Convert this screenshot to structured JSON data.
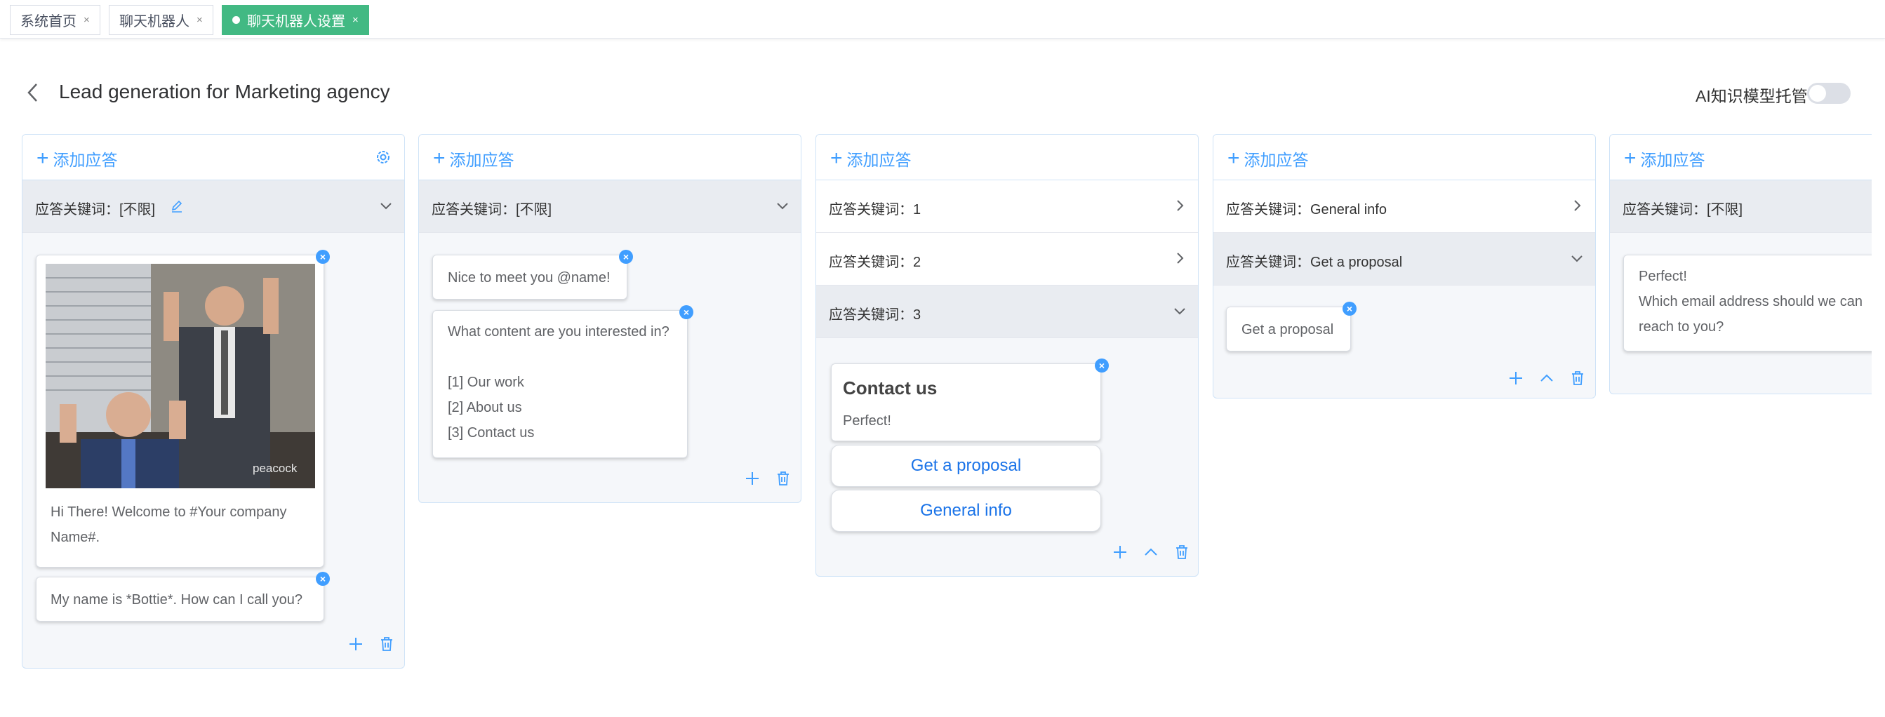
{
  "tabs": [
    {
      "label": "系统首页"
    },
    {
      "label": "聊天机器人"
    },
    {
      "label": "聊天机器人设置"
    }
  ],
  "page": {
    "title": "Lead generation for Marketing agency",
    "ai_label": "AI知识模型托管",
    "ai_enabled": false
  },
  "common": {
    "add_label": "添加应答",
    "close_glyph": "×"
  },
  "columns": [
    {
      "keywords": [
        {
          "label": "应答关键词：[不限]",
          "open": true
        }
      ],
      "cards": [
        {
          "image_watermark": "peacock",
          "text": "Hi There! Welcome to #Your company Name#."
        },
        {
          "text": "My name is *Bottie*. How can I call you?"
        }
      ]
    },
    {
      "keywords": [
        {
          "label": "应答关键词：[不限]",
          "open": true
        }
      ],
      "cards": [
        {
          "text": "Nice to meet you @name!"
        },
        {
          "lines": [
            "What content are you interested in?",
            "",
            "[1] Our work",
            "[2] About us",
            "[3] Contact us"
          ]
        }
      ]
    },
    {
      "keywords": [
        {
          "label": "应答关键词：1",
          "open": false
        },
        {
          "label": "应答关键词：2",
          "open": false
        },
        {
          "label": "应答关键词：3",
          "open": true
        }
      ],
      "cards": [
        {
          "title": "Contact us",
          "text": "Perfect!"
        }
      ],
      "buttons": [
        "Get a proposal",
        "General info"
      ]
    },
    {
      "keywords": [
        {
          "label": "应答关键词：General info",
          "open": false
        },
        {
          "label": "应答关键词：Get a proposal",
          "open": true
        }
      ],
      "cards": [
        {
          "text": "Get a proposal"
        }
      ]
    },
    {
      "keywords": [
        {
          "label": "应答关键词：[不限]",
          "open": true
        }
      ],
      "cards": [
        {
          "lines": [
            "Perfect!",
            "Which email address should we can",
            "reach to you?"
          ]
        }
      ]
    }
  ]
}
